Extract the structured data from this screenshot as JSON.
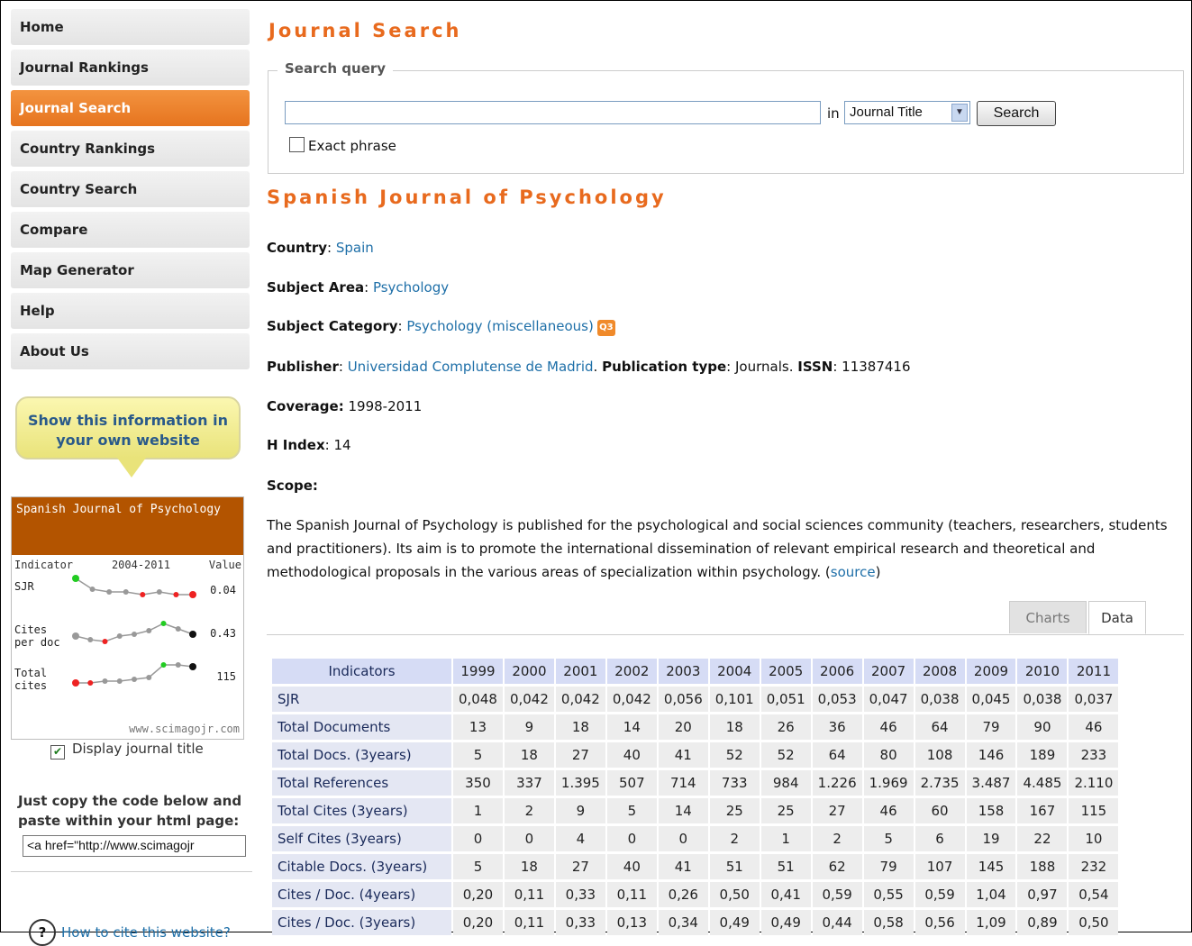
{
  "nav": [
    "Home",
    "Journal Rankings",
    "Journal Search",
    "Country Rankings",
    "Country Search",
    "Compare",
    "Map Generator",
    "Help",
    "About Us"
  ],
  "nav_active": "Journal Search",
  "accent_color": "#e86a1e",
  "bubble": {
    "line1": "Show this information in",
    "line2": "your own website"
  },
  "widget": {
    "title": "Spanish Journal of Psychology",
    "col_indicator": "Indicator",
    "col_years": "2004-2011",
    "col_value": "Value",
    "rows": [
      {
        "label1": "SJR",
        "label2": "",
        "value": "0.04"
      },
      {
        "label1": "Cites",
        "label2": "per doc",
        "value": "0.43"
      },
      {
        "label1": "Total",
        "label2": "cites",
        "value": "115"
      }
    ],
    "footer": "www.scimagojr.com"
  },
  "display_title_label": "Display journal title",
  "copy_line1": "Just copy the code below and",
  "copy_line2": "paste within your html page:",
  "code_value": "<a href=\"http://www.scimagojr",
  "howto": "How to cite this website?",
  "search": {
    "title": "Journal Search",
    "legend": "Search query",
    "query_value": "",
    "in_label": "in",
    "field_value": "Journal Title",
    "button": "Search",
    "exact_label": "Exact phrase"
  },
  "journal": {
    "name": "Spanish Journal of Psychology",
    "country_label": "Country",
    "country": "Spain",
    "subject_area_label": "Subject Area",
    "subject_area": "Psychology",
    "subject_category_label": "Subject Category",
    "subject_category": "Psychology (miscellaneous)",
    "quartile": "Q3",
    "publisher_label": "Publisher",
    "publisher": "Universidad Complutense de Madrid",
    "pubtype_label": "Publication type",
    "pubtype": "Journals",
    "issn_label": "ISSN",
    "issn": "11387416",
    "coverage_label": "Coverage:",
    "coverage": "1998-2011",
    "hindex_label": "H Index",
    "hindex": "14",
    "scope_label": "Scope:",
    "scope_text": "The Spanish Journal of Psychology is published for the psychological and social sciences community (teachers, researchers, students and practitioners). Its aim is to promote the international dissemination of relevant empirical research and theoretical and methodological proposals in the various areas of specialization within psychology.",
    "scope_source": "source"
  },
  "tabs": [
    "Charts",
    "Data"
  ],
  "table": {
    "header_label": "Indicators",
    "years": [
      "1999",
      "2000",
      "2001",
      "2002",
      "2003",
      "2004",
      "2005",
      "2006",
      "2007",
      "2008",
      "2009",
      "2010",
      "2011"
    ],
    "rows": [
      {
        "label": "SJR",
        "values": [
          "0,048",
          "0,042",
          "0,042",
          "0,042",
          "0,056",
          "0,101",
          "0,051",
          "0,053",
          "0,047",
          "0,038",
          "0,045",
          "0,038",
          "0,037"
        ]
      },
      {
        "label": "Total Documents",
        "values": [
          "13",
          "9",
          "18",
          "14",
          "20",
          "18",
          "26",
          "36",
          "46",
          "64",
          "79",
          "90",
          "46"
        ]
      },
      {
        "label": "Total Docs. (3years)",
        "values": [
          "5",
          "18",
          "27",
          "40",
          "41",
          "52",
          "52",
          "64",
          "80",
          "108",
          "146",
          "189",
          "233"
        ]
      },
      {
        "label": "Total References",
        "values": [
          "350",
          "337",
          "1.395",
          "507",
          "714",
          "733",
          "984",
          "1.226",
          "1.969",
          "2.735",
          "3.487",
          "4.485",
          "2.110"
        ]
      },
      {
        "label": "Total Cites (3years)",
        "values": [
          "1",
          "2",
          "9",
          "5",
          "14",
          "25",
          "25",
          "27",
          "46",
          "60",
          "158",
          "167",
          "115"
        ]
      },
      {
        "label": "Self Cites (3years)",
        "values": [
          "0",
          "0",
          "4",
          "0",
          "0",
          "2",
          "1",
          "2",
          "5",
          "6",
          "19",
          "22",
          "10"
        ]
      },
      {
        "label": "Citable Docs. (3years)",
        "values": [
          "5",
          "18",
          "27",
          "40",
          "41",
          "51",
          "51",
          "62",
          "79",
          "107",
          "145",
          "188",
          "232"
        ]
      },
      {
        "label": "Cites / Doc. (4years)",
        "values": [
          "0,20",
          "0,11",
          "0,33",
          "0,11",
          "0,26",
          "0,50",
          "0,41",
          "0,59",
          "0,55",
          "0,59",
          "1,04",
          "0,97",
          "0,54"
        ]
      },
      {
        "label": "Cites / Doc. (3years)",
        "values": [
          "0,20",
          "0,11",
          "0,33",
          "0,13",
          "0,34",
          "0,49",
          "0,49",
          "0,44",
          "0,58",
          "0,56",
          "1,09",
          "0,89",
          "0,50"
        ]
      }
    ]
  }
}
